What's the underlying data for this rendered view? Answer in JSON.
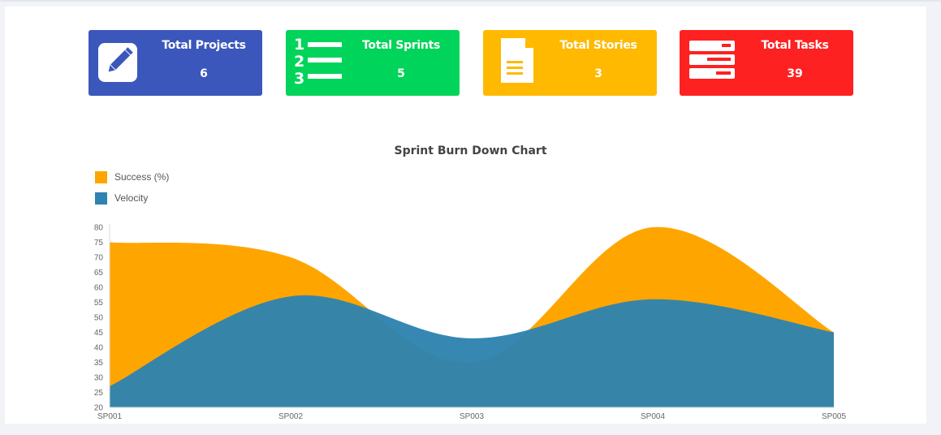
{
  "stats": [
    {
      "title": "Total Projects",
      "value": "6",
      "color": "#3b57bc",
      "icon": "pencil-icon"
    },
    {
      "title": "Total Sprints",
      "value": "5",
      "color": "#00d45a",
      "icon": "numbered-list-icon"
    },
    {
      "title": "Total Stories",
      "value": "3",
      "color": "#ffb900",
      "icon": "document-icon"
    },
    {
      "title": "Total Tasks",
      "value": "39",
      "color": "#fe2121",
      "icon": "tasks-icon"
    }
  ],
  "chart_data": {
    "type": "area",
    "title": "Sprint Burn Down Chart",
    "categories": [
      "SP001",
      "SP002",
      "SP003",
      "SP004",
      "SP005"
    ],
    "series": [
      {
        "name": "Success (%)",
        "values": [
          75,
          70,
          35,
          80,
          45
        ],
        "color": "#ffa500"
      },
      {
        "name": "Velocity",
        "values": [
          27,
          57,
          43,
          56,
          45
        ],
        "color": "#2e83b0"
      }
    ],
    "ylim": [
      20,
      80
    ],
    "yticks": [
      20,
      25,
      30,
      35,
      40,
      45,
      50,
      55,
      60,
      65,
      70,
      75,
      80
    ],
    "legend_position": "top-left",
    "grid": false
  }
}
